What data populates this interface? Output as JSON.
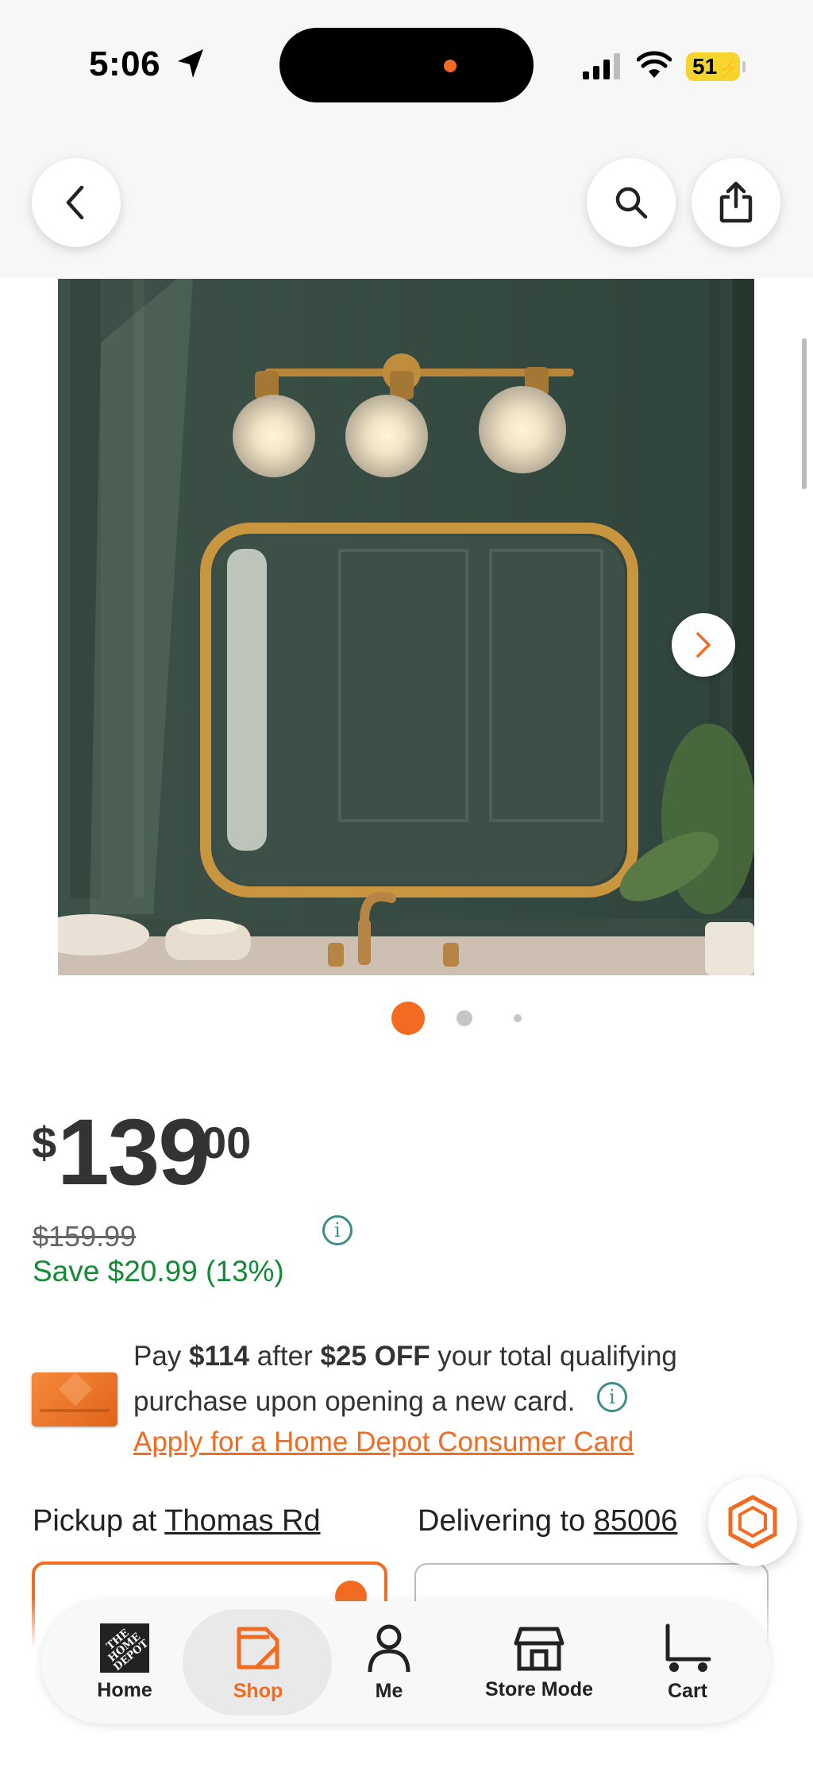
{
  "status_bar": {
    "time": "5:06",
    "battery": "51",
    "icons": [
      "location-arrow-icon",
      "signal-icon",
      "wifi-icon",
      "battery-charging-icon"
    ]
  },
  "header": {
    "back_icon": "chevron-left-icon",
    "search_icon": "search-icon",
    "share_icon": "share-icon"
  },
  "gallery": {
    "image_alt": "Three-light gold bathroom vanity fixture with crackled glass globes above a gold framed mirror",
    "total_images": 3,
    "active_index": 0,
    "next_icon": "chevron-right-icon"
  },
  "price": {
    "currency": "$",
    "dollars": "139",
    "cents": "00",
    "was": "$159.99",
    "save": "Save $20.99 (13%)"
  },
  "card_offer": {
    "pay_prefix": "Pay ",
    "pay_amount": "$114",
    "after": " after ",
    "discount": "$25 OFF",
    "line1_suffix": " your total qualifying",
    "line2": "purchase upon opening a new card.",
    "apply_link": "Apply for a Home Depot Consumer Card"
  },
  "fulfillment": {
    "pickup_label": "Pickup at ",
    "pickup_store": "Thomas Rd",
    "delivery_label": "Delivering to ",
    "delivery_zip": "85006"
  },
  "tab_bar": {
    "tabs": [
      {
        "label": "Home",
        "icon": "home-depot-logo-icon"
      },
      {
        "label": "Shop",
        "icon": "shop-tag-icon",
        "active": true
      },
      {
        "label": "Me",
        "icon": "person-icon"
      },
      {
        "label": "Store Mode",
        "icon": "store-icon"
      },
      {
        "label": "Cart",
        "icon": "cart-icon"
      }
    ]
  },
  "colors": {
    "brand": "#f26b21",
    "save_green": "#138a36",
    "info_teal": "#3c8c8c"
  }
}
